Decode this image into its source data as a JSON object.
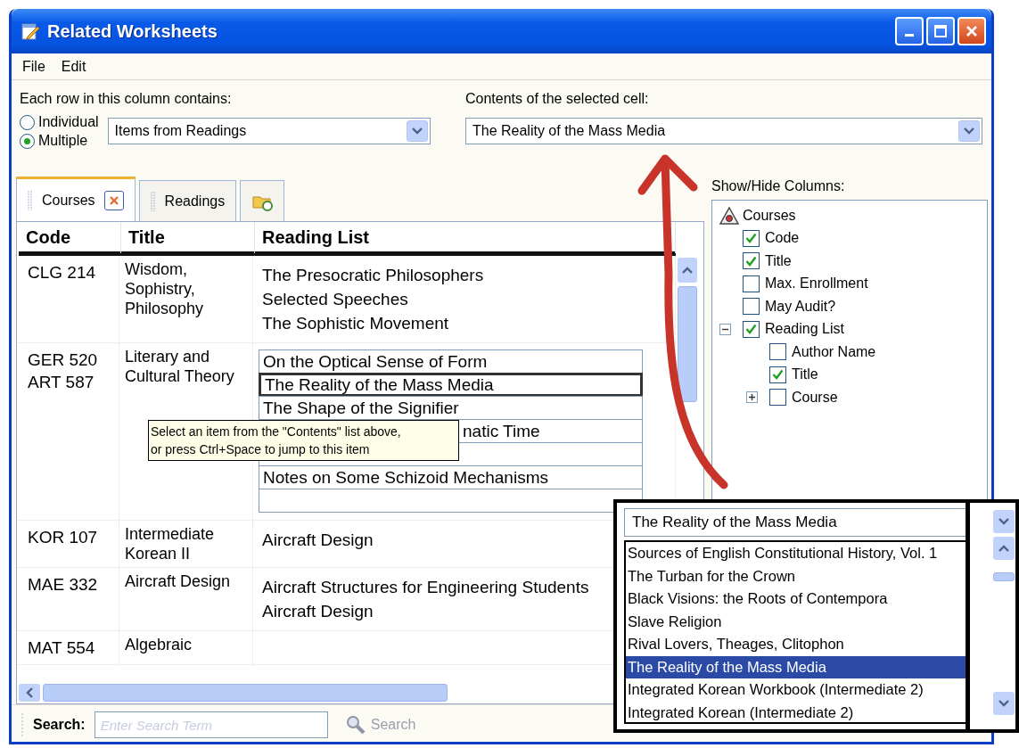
{
  "window": {
    "title": "Related Worksheets"
  },
  "menu": [
    "File",
    "Edit"
  ],
  "row_contents": {
    "label": "Each row in this column contains:",
    "options": [
      {
        "label": "Individual",
        "selected": false
      },
      {
        "label": "Multiple",
        "selected": true
      }
    ],
    "dropdown": {
      "value": "Items from Readings"
    }
  },
  "cell_contents": {
    "label": "Contents of the selected cell:",
    "dropdown": {
      "value": "The Reality of the Mass Media"
    }
  },
  "tabs": [
    {
      "kind": "text",
      "label": "Courses",
      "selected": true,
      "closable": true
    },
    {
      "kind": "text",
      "label": "Readings",
      "selected": false,
      "closable": false
    },
    {
      "kind": "icon",
      "selected": false,
      "closable": false
    }
  ],
  "table": {
    "columns": [
      "Code",
      "Title",
      "Reading List"
    ],
    "rows": [
      {
        "kind": "plain",
        "code": "CLG 214",
        "title": "Wisdom, Sophistry, Philosophy",
        "readings": [
          "The Presocratic Philosophers",
          "Selected Speeches",
          "The Sophistic Movement"
        ]
      },
      {
        "kind": "editor",
        "code": "GER 520\nART 587",
        "title": "Literary and Cultural Theory",
        "readings": [
          {
            "text": "On the Optical Sense of Form",
            "selected": false
          },
          {
            "text": "The Reality of the Mass Media",
            "selected": true
          },
          {
            "text": "The Shape of the Signifier",
            "selected": false
          },
          {
            "text": "natic Time",
            "selected": false,
            "kind": "covered"
          },
          {
            "selected": false
          },
          {
            "text": "Notes on Some Schizoid Mechanisms",
            "selected": false
          },
          {
            "selected": false
          }
        ],
        "tooltip": "Select an item from the \"Contents\" list above,\nor press Ctrl+Space to jump to this item"
      },
      {
        "kind": "plain",
        "code": "KOR 107",
        "title": "Intermediate Korean II",
        "readings": [
          "Aircraft Design"
        ]
      },
      {
        "kind": "plain",
        "code": "MAE 332",
        "title": "Aircraft Design",
        "readings": [
          "Aircraft Structures for Engineering Students",
          "Aircraft Design"
        ]
      },
      {
        "kind": "plain",
        "code": "MAT 554",
        "title": "Algebraic"
      }
    ]
  },
  "columns_panel": {
    "label": "Show/Hide Columns:",
    "tree": [
      {
        "label": "Courses",
        "children": [
          {
            "label": "Code",
            "checked": true
          },
          {
            "label": "Title",
            "checked": true
          },
          {
            "label": "Max. Enrollment",
            "checked": false
          },
          {
            "label": "May Audit?",
            "checked": false
          },
          {
            "label": "Reading List",
            "checked": true,
            "expanded": true,
            "children": [
              {
                "label": "Author Name",
                "checked": false
              },
              {
                "label": "Title",
                "checked": true
              },
              {
                "label": "Course",
                "checked": false,
                "expanded": false
              }
            ]
          }
        ]
      }
    ]
  },
  "search": {
    "label": "Search:",
    "placeholder": "Enter Search Term",
    "button": {
      "label": "Search",
      "disabled": true
    }
  },
  "callout": {
    "dropdown": {
      "value": "The Reality of the Mass Media"
    },
    "items": [
      {
        "label": "Sources of English Constitutional History, Vol. 1",
        "selected": false
      },
      {
        "label": "The Turban for the Crown",
        "selected": false
      },
      {
        "label": "Black Visions: the Roots of Contempora",
        "selected": false
      },
      {
        "label": "Slave Religion",
        "selected": false
      },
      {
        "label": "Rival Lovers, Theages, Clitophon",
        "selected": false
      },
      {
        "label": "The Reality of the Mass Media",
        "selected": true
      },
      {
        "label": "Integrated Korean Workbook (Intermediate 2)",
        "selected": false
      },
      {
        "label": "Integrated Korean (Intermediate 2)",
        "selected": false
      }
    ]
  }
}
